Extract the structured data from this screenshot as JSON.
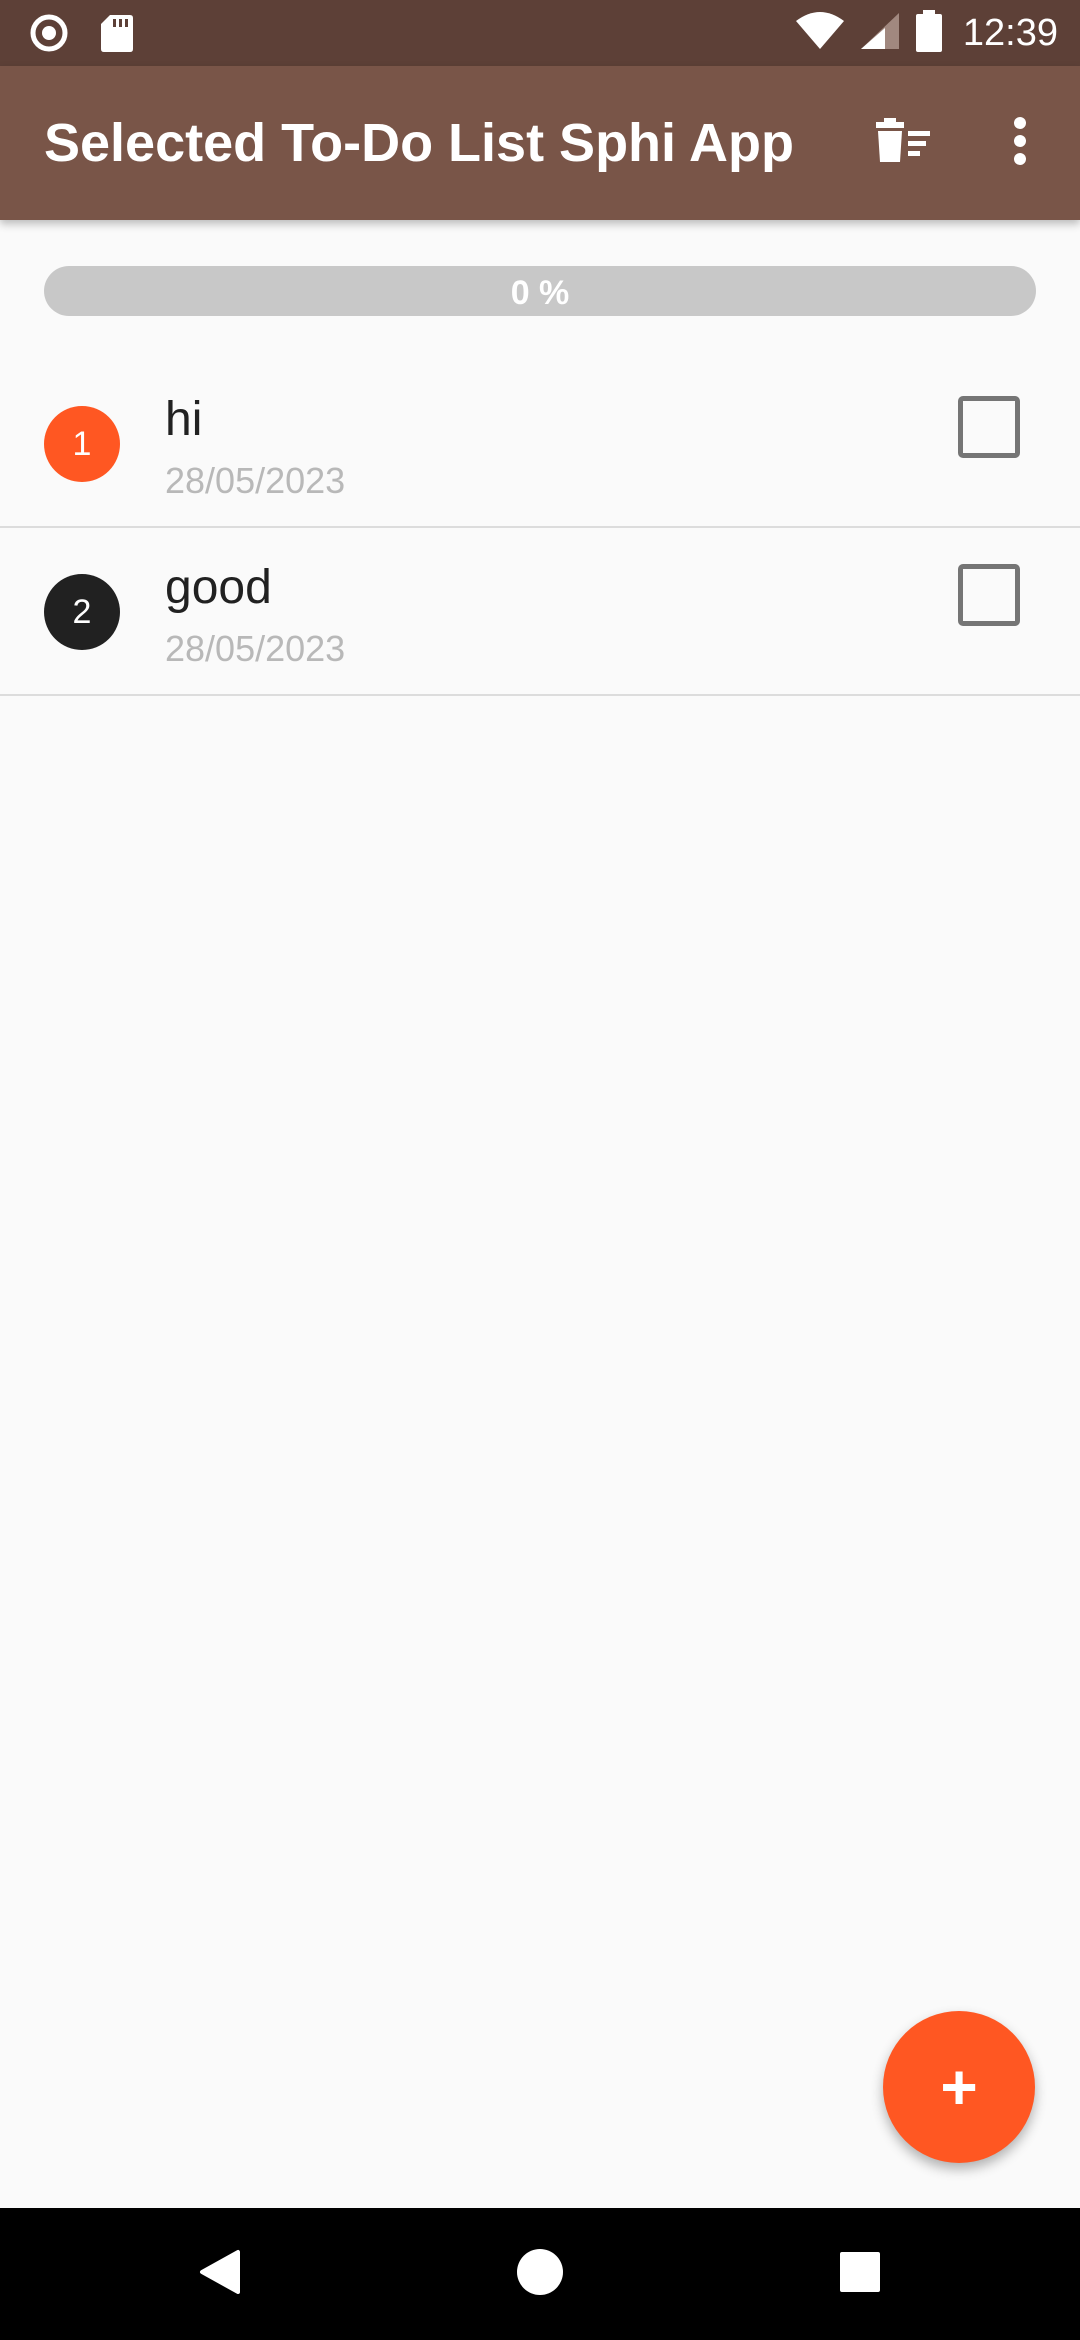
{
  "status_bar": {
    "time": "12:39",
    "left_icons": [
      "record-icon",
      "sd-card-icon"
    ],
    "right_icons": [
      "wifi-icon",
      "cell-signal-icon",
      "battery-icon"
    ]
  },
  "app_bar": {
    "title": "Selected To-Do List Sphi App",
    "actions": [
      "delete-list-icon",
      "more-vert-icon"
    ],
    "color": "#795548"
  },
  "progress": {
    "label": "0 %",
    "value": 0
  },
  "todos": [
    {
      "index": "1",
      "title": "hi",
      "date": "28/05/2023",
      "checked": false,
      "badge_color": "#ff5722"
    },
    {
      "index": "2",
      "title": "good",
      "date": "28/05/2023",
      "checked": false,
      "badge_color": "#212121"
    }
  ],
  "fab": {
    "label": "+",
    "color": "#ff5722"
  },
  "nav_bar": {
    "buttons": [
      "back-icon",
      "home-icon",
      "recents-icon"
    ]
  }
}
